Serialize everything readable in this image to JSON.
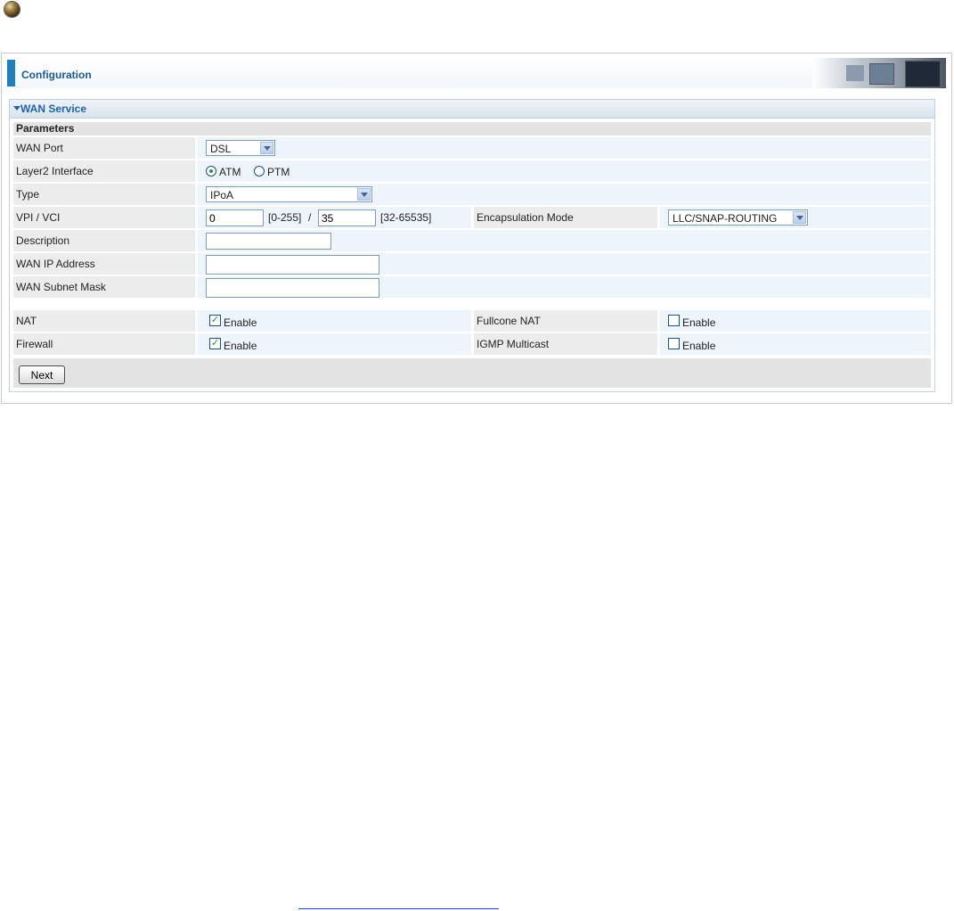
{
  "header": {
    "title": "Configuration"
  },
  "section": {
    "title": "WAN Service",
    "params_title": "Parameters"
  },
  "form": {
    "wan_port": {
      "label": "WAN Port",
      "value": "DSL"
    },
    "layer2": {
      "label": "Layer2 Interface",
      "options": [
        "ATM",
        "PTM"
      ],
      "selected": "ATM"
    },
    "type": {
      "label": "Type",
      "value": "IPoA"
    },
    "vpi_vci": {
      "label": "VPI / VCI",
      "vpi": "0",
      "vpi_range": "[0-255]",
      "sep": "/",
      "vci": "35",
      "vci_range": "[32-65535]"
    },
    "encap": {
      "label": "Encapsulation Mode",
      "value": "LLC/SNAP-ROUTING"
    },
    "description": {
      "label": "Description",
      "value": ""
    },
    "wan_ip": {
      "label": "WAN IP Address",
      "value": ""
    },
    "subnet": {
      "label": "WAN Subnet Mask",
      "value": ""
    },
    "nat": {
      "label": "NAT",
      "option": "Enable",
      "checked": true
    },
    "fullcone": {
      "label": "Fullcone NAT",
      "option": "Enable",
      "checked": false
    },
    "firewall": {
      "label": "Firewall",
      "option": "Enable",
      "checked": true
    },
    "igmp": {
      "label": "IGMP Multicast",
      "option": "Enable",
      "checked": false
    }
  },
  "buttons": {
    "next": "Next"
  },
  "icons": {
    "bullet": "bullet-sphere-icon",
    "dropdown": "chevron-down-icon",
    "section_toggle": "triangle-down-icon",
    "check": "check-icon"
  },
  "colors": {
    "accent": "#1f7fc2",
    "title": "#1b5a94",
    "label_bg": "#ececec",
    "value_bg": "#eef4fb"
  }
}
